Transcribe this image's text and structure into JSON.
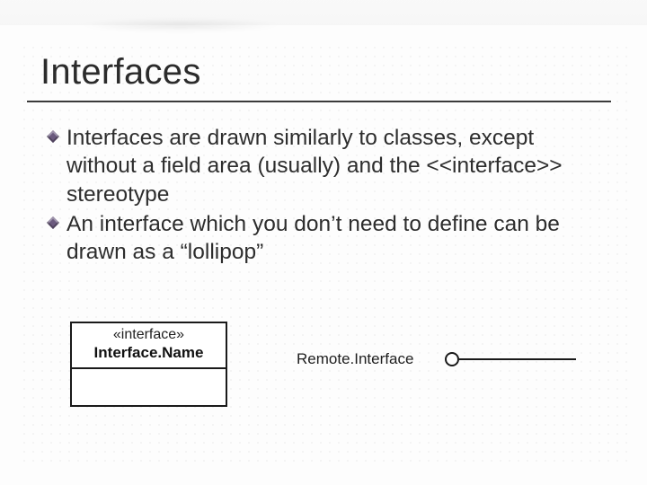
{
  "slide": {
    "title": "Interfaces",
    "bullets": [
      "Interfaces are drawn similarly to classes, except without a field area (usually) and the <<interface>> stereotype",
      "An interface which you don’t need to define can be drawn as a “lollipop”"
    ]
  },
  "uml": {
    "stereotype": "«interface»",
    "class_name": "Interface.Name"
  },
  "lollipop": {
    "label": "Remote.Interface"
  }
}
